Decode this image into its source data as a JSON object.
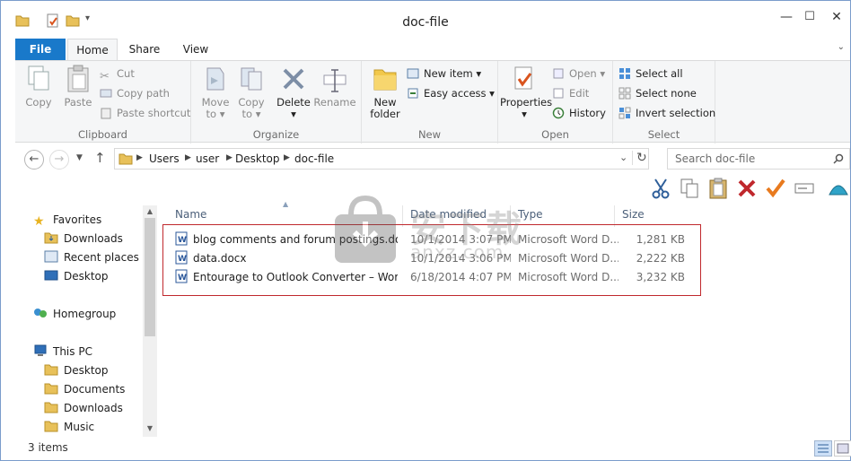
{
  "window": {
    "title": "doc-file"
  },
  "ribbon_tabs": [
    {
      "label": "File"
    },
    {
      "label": "Home"
    },
    {
      "label": "Share"
    },
    {
      "label": "View"
    }
  ],
  "ribbon": {
    "clipboard": {
      "label": "Clipboard",
      "copy": "Copy",
      "paste": "Paste",
      "cut": "Cut",
      "copy_path": "Copy path",
      "paste_shortcut": "Paste shortcut"
    },
    "organize": {
      "label": "Organize",
      "move_to_1": "Move",
      "move_to_2": "to",
      "copy_to_1": "Copy",
      "copy_to_2": "to",
      "delete": "Delete",
      "rename": "Rename"
    },
    "new": {
      "label": "New",
      "new_folder_1": "New",
      "new_folder_2": "folder",
      "new_item": "New item",
      "easy_access": "Easy access"
    },
    "open": {
      "label": "Open",
      "properties": "Properties",
      "open": "Open",
      "edit": "Edit",
      "history": "History"
    },
    "select": {
      "label": "Select",
      "select_all": "Select all",
      "select_none": "Select none",
      "invert_selection": "Invert selection"
    }
  },
  "address": {
    "crumbs": [
      "Users",
      "user",
      "Desktop",
      "doc-file"
    ],
    "search_placeholder": "Search doc-file"
  },
  "nav_pane": {
    "favorites": "Favorites",
    "fav_items": [
      "Downloads",
      "Recent places",
      "Desktop"
    ],
    "homegroup": "Homegroup",
    "this_pc": "This PC",
    "pc_items": [
      "Desktop",
      "Documents",
      "Downloads",
      "Music"
    ]
  },
  "columns": {
    "name": "Name",
    "date": "Date modified",
    "type": "Type",
    "size": "Size"
  },
  "files": [
    {
      "name": "blog comments and forum postings.docx",
      "date": "10/1/2014 3:07 PM",
      "type": "Microsoft Word D...",
      "size": "1,281 KB"
    },
    {
      "name": "data.docx",
      "date": "10/1/2014 3:06 PM",
      "type": "Microsoft Word D...",
      "size": "2,222 KB"
    },
    {
      "name": "Entourage to Outlook Converter – Worth ...",
      "date": "6/18/2014 4:07 PM",
      "type": "Microsoft Word D...",
      "size": "3,232 KB"
    }
  ],
  "status": {
    "item_count": "3 items"
  },
  "watermark": {
    "text": "安下载",
    "sub": "anxz.com"
  },
  "colors": {
    "accent": "#1979ca",
    "highlight": "#c0282d",
    "ribbon_bg": "#f5f6f7"
  }
}
